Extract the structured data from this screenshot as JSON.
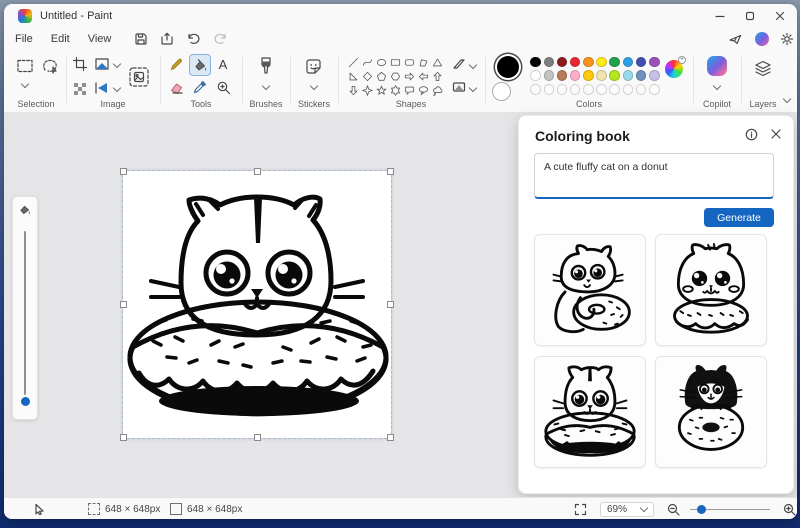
{
  "window": {
    "title": "Untitled - Paint"
  },
  "menu": {
    "items": [
      "File",
      "Edit",
      "View"
    ]
  },
  "ribbon": {
    "labels": {
      "selection": "Selection",
      "image": "Image",
      "tools": "Tools",
      "brushes": "Brushes",
      "stickers": "Stickers",
      "shapes": "Shapes",
      "colors": "Colors",
      "copilot": "Copilot",
      "layers": "Layers"
    },
    "text_tool_glyph": "A"
  },
  "palette": {
    "foreground": "#000000",
    "background": "#ffffff",
    "row1": [
      "#000000",
      "#7f7f7f",
      "#8b1b1b",
      "#e8282e",
      "#f7941d",
      "#ffe81a",
      "#23a14c",
      "#2e9fe6",
      "#4250b4",
      "#9b52b8"
    ],
    "row2": [
      "#ffffff",
      "#c3c3c3",
      "#b97a57",
      "#ffaec9",
      "#ffc90e",
      "#efe4b0",
      "#b5e61d",
      "#99d9ea",
      "#7092be",
      "#c8bfe7"
    ],
    "empty_count": 10
  },
  "shapes": {
    "items": [
      "line",
      "curve",
      "oval",
      "rectangle",
      "rounded-rectangle",
      "polygon",
      "triangle",
      "right-triangle",
      "diamond",
      "pentagon",
      "hexagon",
      "arrow-right",
      "arrow-left",
      "arrow-up",
      "arrow-down",
      "star-4",
      "star-5",
      "star-6",
      "callout-rounded",
      "callout-oval",
      "cloud-callout"
    ]
  },
  "coloring_book": {
    "title": "Coloring book",
    "prompt": "A cute fluffy cat on a donut",
    "generate_label": "Generate",
    "thumbnails": [
      "cat-hugging-donut",
      "fluffy-cat-on-donut",
      "cat-in-sprinkle-donut",
      "tuxedo-cat-behind-donut"
    ]
  },
  "statusbar": {
    "selection_size": "648 × 648px",
    "canvas_size": "648 × 648px",
    "zoom_level": "69%"
  },
  "theme": {
    "accent": "#1466c0"
  }
}
